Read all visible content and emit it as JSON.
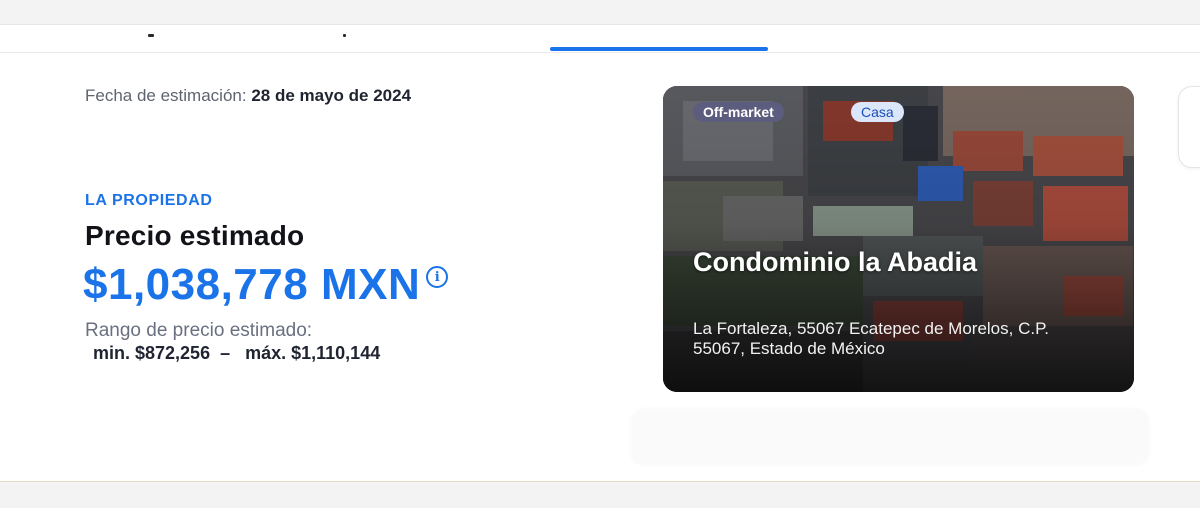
{
  "estimate": {
    "date_label": "Fecha de estimación:",
    "date_value": "28 de mayo de 2024"
  },
  "property": {
    "eyebrow": "LA PROPIEDAD",
    "title": "Precio estimado",
    "price": "$1,038,778 MXN",
    "info_icon_glyph": "i",
    "range_label": "Rango de precio estimado:",
    "range_values": "min. $872,256  –   máx. $1,110,144"
  },
  "card": {
    "badge_status": "Off-market",
    "badge_type": "Casa",
    "title": "Condominio la Abadia",
    "address": "La Fortaleza, 55067 Ecatepec de Morelos, C.P. 55067, Estado de México"
  },
  "colors": {
    "accent": "#1a73e8",
    "badge_status_bg": "#5c5c7e",
    "badge_type_bg": "#dbe6fb"
  },
  "icons": {
    "info": "info-icon"
  }
}
